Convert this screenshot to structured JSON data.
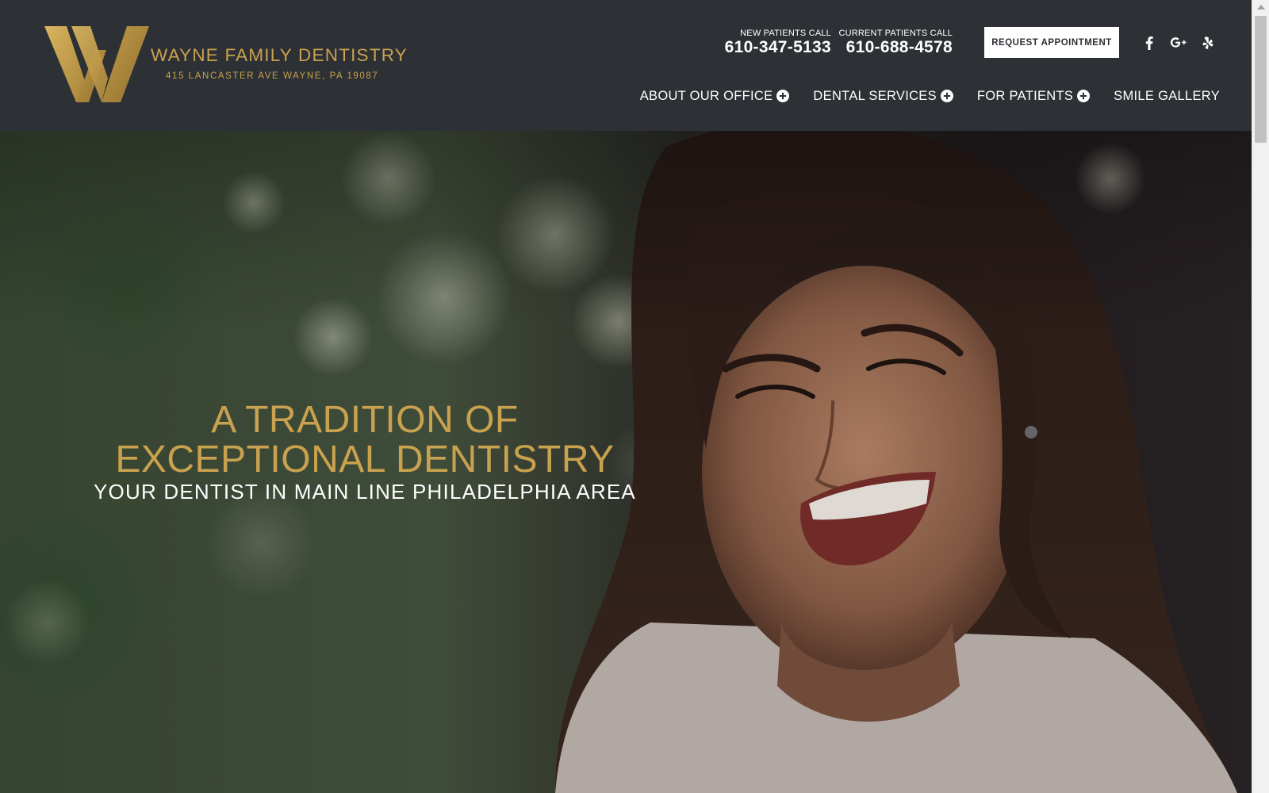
{
  "brand": {
    "name": "WAYNE FAMILY DENTISTRY",
    "address": "415 LANCASTER AVE WAYNE, PA 19087",
    "gold_color": "#c9a24f",
    "header_bg": "#2d3035"
  },
  "contact": {
    "new_patients_label": "NEW PATIENTS CALL",
    "new_patients_phone": "610-347-5133",
    "current_patients_label": "CURRENT PATIENTS CALL",
    "current_patients_phone": "610-688-4578"
  },
  "cta": {
    "request_label": "REQUEST APPOINTMENT"
  },
  "social": [
    {
      "icon": "facebook-icon"
    },
    {
      "icon": "google-plus-icon"
    },
    {
      "icon": "yelp-icon"
    }
  ],
  "nav": {
    "items": [
      {
        "label": "ABOUT OUR OFFICE",
        "has_submenu": true
      },
      {
        "label": "DENTAL SERVICES",
        "has_submenu": true
      },
      {
        "label": "FOR PATIENTS",
        "has_submenu": true
      },
      {
        "label": "SMILE GALLERY",
        "has_submenu": false
      }
    ]
  },
  "hero": {
    "title_line1": "A TRADITION OF",
    "title_line2": "EXCEPTIONAL DENTISTRY",
    "subtitle": "YOUR DENTIST IN MAIN LINE PHILADELPHIA AREA"
  }
}
